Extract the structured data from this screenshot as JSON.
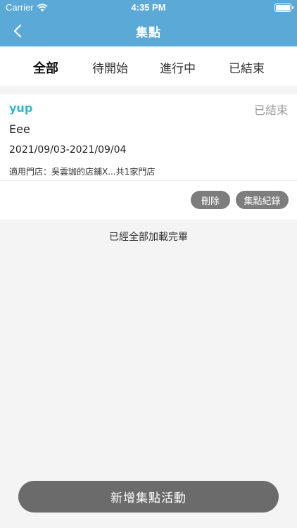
{
  "status_bar": {
    "carrier": "Carrier",
    "time": "4:35 PM"
  },
  "nav": {
    "title": "集點",
    "back_icon": "chevron-left-icon"
  },
  "tabs": [
    {
      "label": "全部",
      "active": true
    },
    {
      "label": "待開始",
      "active": false
    },
    {
      "label": "進行中",
      "active": false
    },
    {
      "label": "已結束",
      "active": false
    }
  ],
  "card": {
    "name": "yup",
    "status": "已結束",
    "description": "Eee",
    "date_range": "2021/09/03-2021/09/04",
    "store_label": "適用門店：",
    "store_value": "吳雲珈的店鋪X...共1家門店",
    "delete_label": "刪除",
    "record_label": "集點紀錄"
  },
  "load_message": "已經全部加載完畢",
  "add_button_label": "新增集點活動",
  "colors": {
    "nav": "#5ba9d6",
    "accent": "#37b3c8",
    "pill": "#7d7d7d",
    "add_button": "#6b6b6b"
  }
}
